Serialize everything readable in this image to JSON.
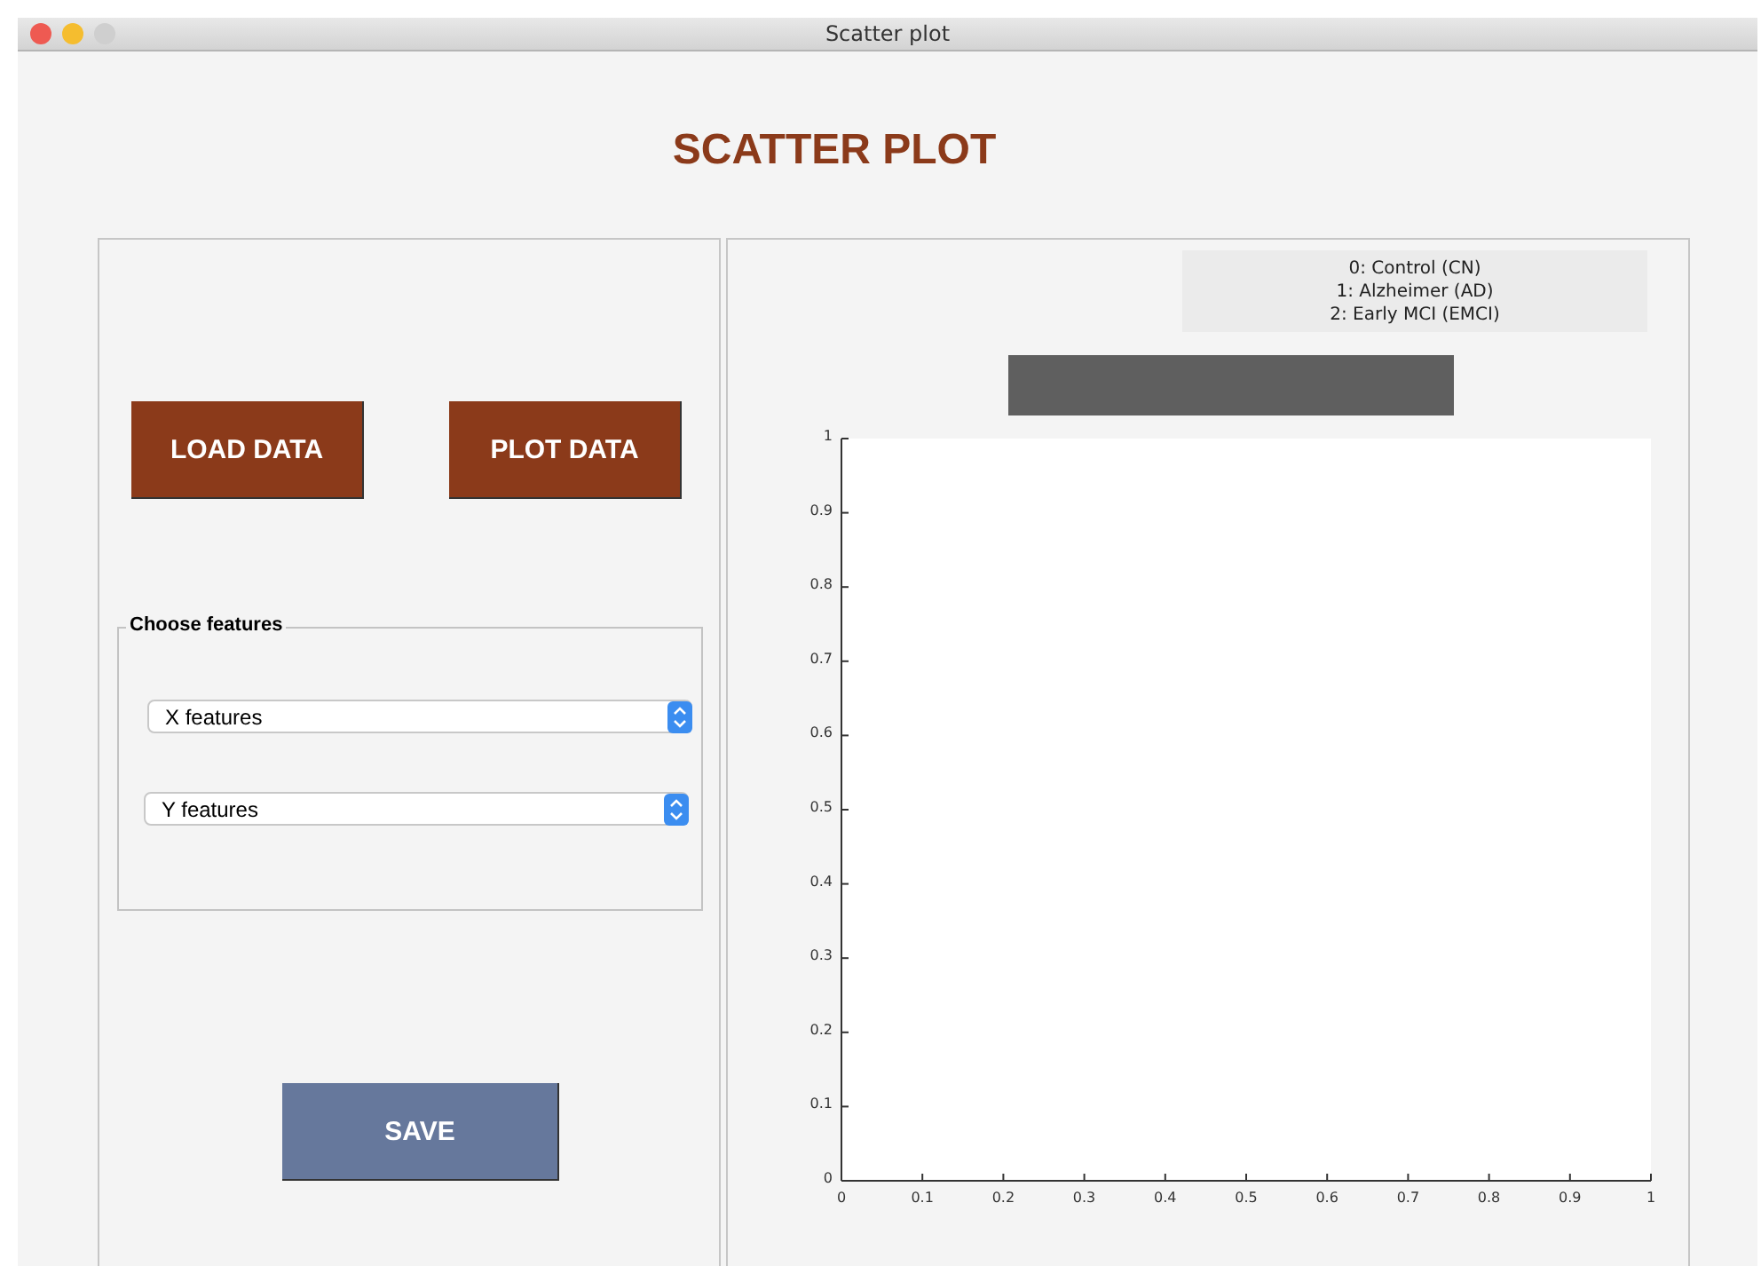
{
  "window": {
    "title": "Scatter plot"
  },
  "heading": "SCATTER PLOT",
  "buttons": [
    {
      "label": "LOAD DATA"
    },
    {
      "label": "PLOT DATA"
    }
  ],
  "features": {
    "title": "Choose features",
    "selects": [
      {
        "value": "X features"
      },
      {
        "value": "Y features"
      }
    ]
  },
  "save_button": {
    "label": "SAVE"
  },
  "legend": [
    "0: Control (CN)",
    "1: Alzheimer (AD)",
    "2: Early MCI (EMCI)"
  ],
  "chart_data": {
    "type": "scatter",
    "xlim": [
      0,
      1
    ],
    "ylim": [
      0,
      1
    ],
    "xticks": [
      {
        "value": 0,
        "label": "0"
      },
      {
        "value": 0.1,
        "label": "0.1"
      },
      {
        "value": 0.2,
        "label": "0.2"
      },
      {
        "value": 0.3,
        "label": "0.3"
      },
      {
        "value": 0.4,
        "label": "0.4"
      },
      {
        "value": 0.5,
        "label": "0.5"
      },
      {
        "value": 0.6,
        "label": "0.6"
      },
      {
        "value": 0.7,
        "label": "0.7"
      },
      {
        "value": 0.8,
        "label": "0.8"
      },
      {
        "value": 0.9,
        "label": "0.9"
      },
      {
        "value": 1,
        "label": "1"
      }
    ],
    "yticks": [
      {
        "value": 0,
        "label": "0"
      },
      {
        "value": 0.1,
        "label": "0.1"
      },
      {
        "value": 0.2,
        "label": "0.2"
      },
      {
        "value": 0.3,
        "label": "0.3"
      },
      {
        "value": 0.4,
        "label": "0.4"
      },
      {
        "value": 0.5,
        "label": "0.5"
      },
      {
        "value": 0.6,
        "label": "0.6"
      },
      {
        "value": 0.7,
        "label": "0.7"
      },
      {
        "value": 0.8,
        "label": "0.8"
      },
      {
        "value": 0.9,
        "label": "0.9"
      },
      {
        "value": 1,
        "label": "1"
      }
    ]
  }
}
